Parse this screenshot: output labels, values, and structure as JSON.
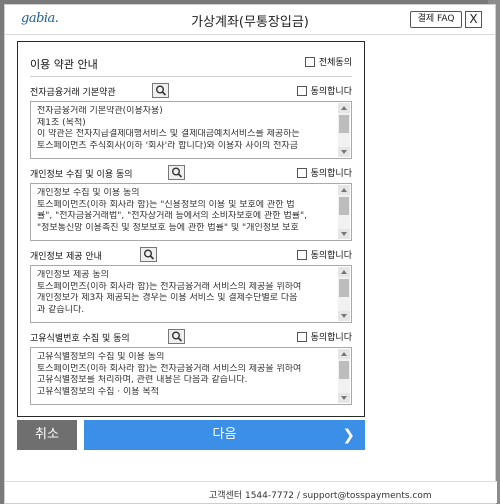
{
  "header": {
    "logo": "gabia.",
    "title": "가상계좌(무통장입금)",
    "faq_label": "결제 FAQ",
    "close_label": "X"
  },
  "agree_all": {
    "label": "이용 약관 안내",
    "check_label": "전체동의"
  },
  "sections": [
    {
      "title": "전자금융거래 기본약관",
      "check_label": "동의합니다",
      "lines": [
        "전자금융거래 기본약관(이용자용)",
        "제1조 (목적)",
        "이 약관은 전자지급결제대행서비스 및 결제대금예치서비스를 제공하는",
        "토스페이먼츠 주식회사(이하 '회사'라 합니다)와 이용자 사이의 전자금"
      ]
    },
    {
      "title": "개인정보 수집 및 이용 동의",
      "check_label": "동의합니다",
      "lines": [
        "개인정보 수집 및 이용 동의",
        "토스페이먼츠(이하 회사라 함)는 \"신용정보의 이용 및 보호에 관한 법",
        "률\", \"전자금융거래법\", \"전자상거래 등에서의 소비자보호에 관한 법률\",",
        "\"정보통신망 이용촉진 및 정보보호 등에 관한 법률\" 및 \"개인정보 보호"
      ]
    },
    {
      "title": "개인정보 제공 안내",
      "check_label": "동의합니다",
      "lines": [
        "개인정보 제공 동의",
        "토스페이먼츠(이하 회사라 함)는 전자금융거래 서비스의 제공을 위하여",
        "개인정보가 제3자 제공되는 경우는 이용 서비스 및 결제수단별로 다음",
        "과 같습니다."
      ]
    },
    {
      "title": "고유식별번호 수집 및 동의",
      "check_label": "동의합니다",
      "lines": [
        "고유식별정보의 수집 및 이용 동의",
        "토스페이먼츠(이하 회사라 함)는 전자금융거래 서비스의 제공을 위하여",
        "고유식별정보를 처리하며, 관련 내용은 다음과 같습니다.",
        "고유식별정보의 수집 · 이용 목적"
      ]
    }
  ],
  "buttons": {
    "cancel": "취소",
    "next": "다음",
    "next_icon": "chevron-right-icon"
  },
  "footer": {
    "support": "고객센터 1544-7772 / support@tosspayments.com"
  },
  "colors": {
    "primary": "#3b8fe6",
    "cancel": "#6f6f6f",
    "logo": "#1f5f9e"
  }
}
